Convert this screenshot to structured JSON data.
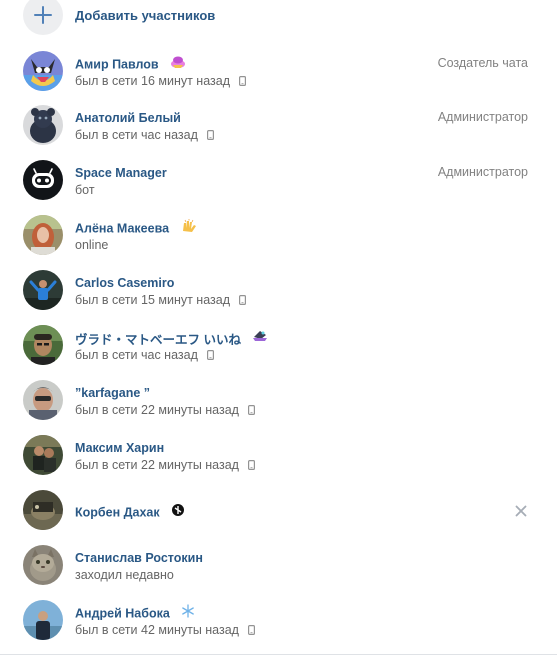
{
  "add_participants": {
    "label": "Добавить участников",
    "icon": "plus-icon"
  },
  "members": [
    {
      "name": "Амир Павлов",
      "status": "был в сети 16 минут назад",
      "role": "Создатель чата",
      "mobile": true,
      "emoji": "pink-emoji"
    },
    {
      "name": "Анатолий Белый",
      "status": "был в сети час назад",
      "role": "Администратор",
      "mobile": true
    },
    {
      "name": "Space Manager",
      "status": "бот",
      "role": "Администратор",
      "mobile": false
    },
    {
      "name": "Алёна Макеева",
      "status": "online",
      "role": "",
      "mobile": false,
      "emoji": "hands-emoji"
    },
    {
      "name": "Carlos Casemiro",
      "status": "был в сети 15 минут назад",
      "role": "",
      "mobile": true
    },
    {
      "name": "ヴラド・マトベーエフ いいね",
      "status": "был в сети час назад",
      "role": "",
      "mobile": true,
      "emoji": "hat-emoji"
    },
    {
      "name": "”karfagane ”",
      "status": "был в сети 22 минуты назад",
      "role": "",
      "mobile": true
    },
    {
      "name": "Максим Харин",
      "status": "был в сети 22 минуты назад",
      "role": "",
      "mobile": true
    },
    {
      "name": "Корбен Дахак",
      "status": "",
      "role": "",
      "mobile": false,
      "emoji": "black-badge-emoji",
      "removable": true
    },
    {
      "name": "Станислав Ростокин",
      "status": "заходил недавно",
      "role": "",
      "mobile": false
    },
    {
      "name": "Андрей Набока",
      "status": "был в сети 42 минуты назад",
      "role": "",
      "mobile": true,
      "emoji": "snowflake-emoji"
    }
  ],
  "colors": {
    "link": "#2a5885",
    "status": "#656565",
    "role": "#828282",
    "accent": "#5181b8",
    "add_bg": "#edeef0"
  }
}
